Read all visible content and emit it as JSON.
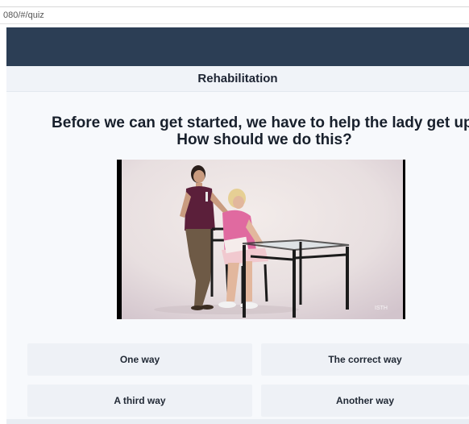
{
  "browser": {
    "url": "080/#/quiz"
  },
  "header": {
    "title": "Rehabilitation"
  },
  "quiz": {
    "question": "Before we can get started, we have to help the lady get up. How should we do this?",
    "video": {
      "watermark": "ISTH"
    },
    "answers": [
      {
        "label": "One way"
      },
      {
        "label": "The correct way"
      },
      {
        "label": "A third way"
      },
      {
        "label": "Another way"
      }
    ]
  },
  "colors": {
    "nav": "#2c3e55",
    "background": "#f7f9fc",
    "answer_bg": "#eef1f6",
    "heading": "#18202c"
  }
}
